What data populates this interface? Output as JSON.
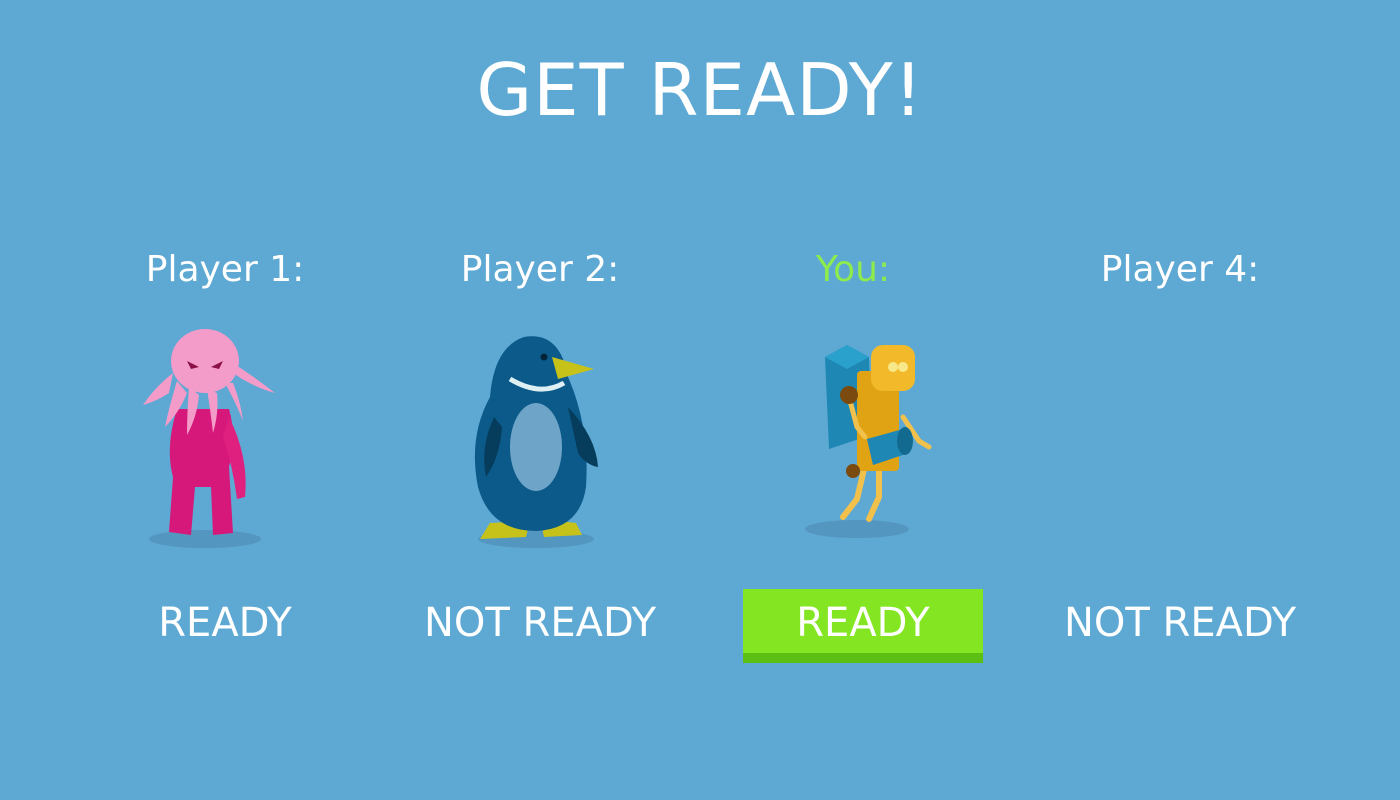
{
  "title": "GET READY!",
  "players": [
    {
      "label": "Player 1:",
      "status": "READY",
      "character": "pink-squid-creature"
    },
    {
      "label": "Player 2:",
      "status": "NOT READY",
      "character": "blue-penguin"
    },
    {
      "label": "You:",
      "status": "READY",
      "character": "yellow-robot-with-backpack",
      "is_self": true
    },
    {
      "label": "Player 4:",
      "status": "NOT READY",
      "character": "none"
    }
  ],
  "colors": {
    "background": "#5ea9d3",
    "you_label": "#8deb4e",
    "ready_button": "#84e623",
    "ready_button_shadow": "#5bbf14"
  }
}
